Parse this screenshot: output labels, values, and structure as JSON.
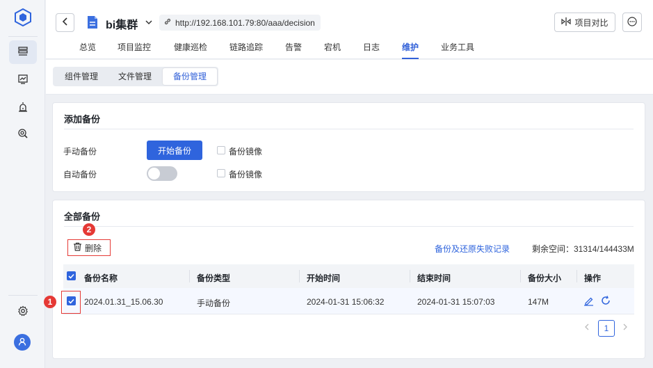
{
  "header": {
    "cluster_name": "bi集群",
    "url": "http://192.168.101.79:80/aaa/decision",
    "compare_label": "项目对比"
  },
  "nav_tabs": [
    "总览",
    "项目监控",
    "健康巡检",
    "链路追踪",
    "告警",
    "宕机",
    "日志",
    "维护",
    "业务工具"
  ],
  "active_nav_tab": "维护",
  "sub_tabs": [
    "组件管理",
    "文件管理",
    "备份管理"
  ],
  "active_sub_tab": "备份管理",
  "add_backup": {
    "title": "添加备份",
    "manual_label": "手动备份",
    "start_button": "开始备份",
    "mirror_label_1": "备份镜像",
    "auto_label": "自动备份",
    "mirror_label_2": "备份镜像",
    "auto_enabled": false
  },
  "all_backups": {
    "title": "全部备份",
    "delete_label": "删除",
    "fail_log_link": "备份及还原失败记录",
    "space_label": "剩余空间：31314/144433M",
    "columns": [
      "备份名称",
      "备份类型",
      "开始时间",
      "结束时间",
      "备份大小",
      "操作"
    ],
    "rows": [
      {
        "name": "2024.01.31_15.06.30",
        "type": "手动备份",
        "start": "2024-01-31 15:06:32",
        "end": "2024-01-31 15:07:03",
        "size": "147M",
        "checked": true
      }
    ],
    "page": "1"
  },
  "annotations": {
    "badge_1": "1",
    "badge_2": "2",
    "color": "#e53935"
  },
  "colors": {
    "accent": "#2f64dd",
    "sidebar_bg": "#f3f5f8"
  }
}
